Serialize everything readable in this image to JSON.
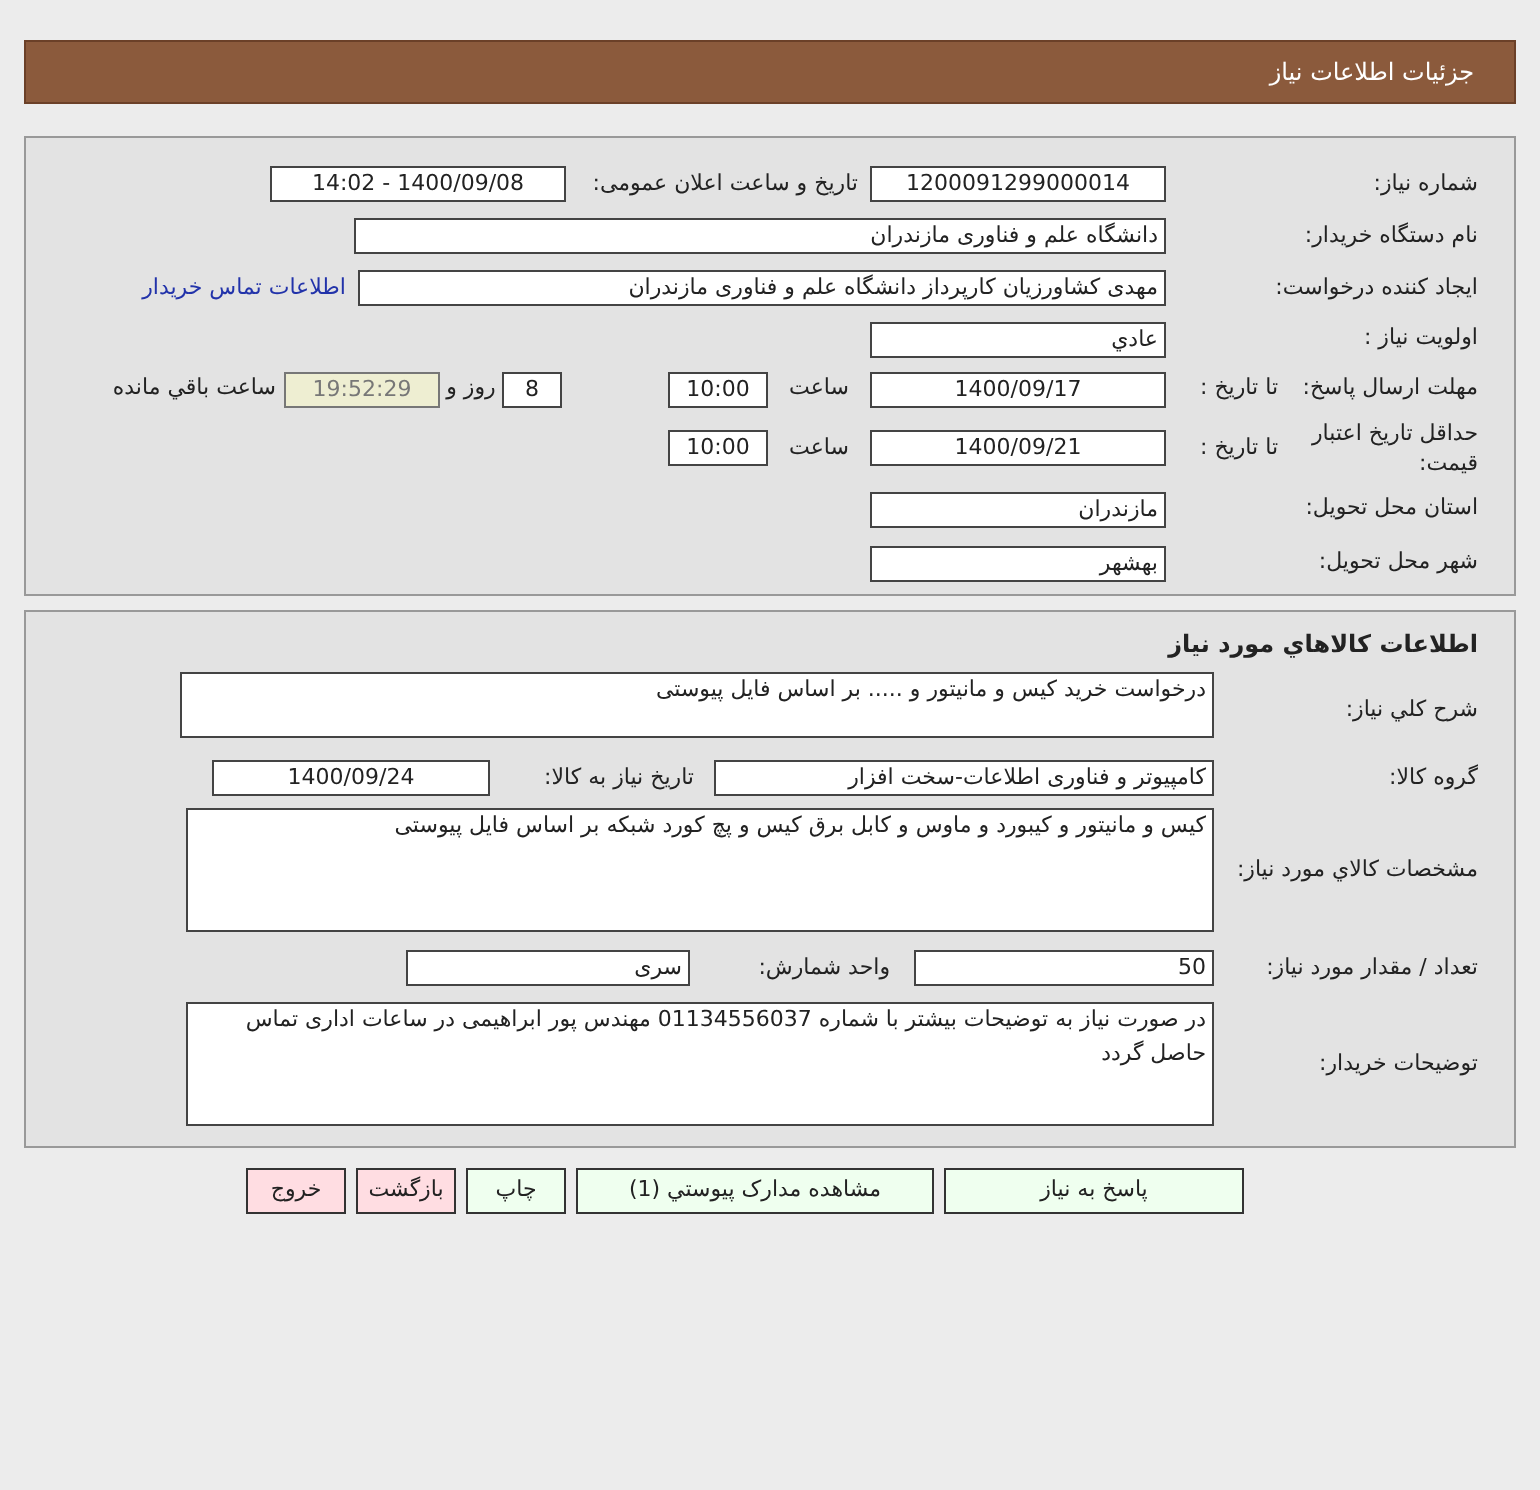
{
  "header": {
    "title": "جزئیات اطلاعات نیاز"
  },
  "general": {
    "need_number": {
      "label": "شماره نیاز:",
      "value": "1200091299000014"
    },
    "announce": {
      "label": "تاریخ و ساعت اعلان عمومی:",
      "value": "1400/09/08 - 14:02"
    },
    "buyer_org": {
      "label": "نام دستگاه خریدار:",
      "value": "دانشگاه علم و فناوری مازندران"
    },
    "requester": {
      "label": "ایجاد کننده درخواست:",
      "value": "مهدی  کشاورزیان کارپرداز دانشگاه علم و فناوری مازندران",
      "link": "اطلاعات تماس خریدار"
    },
    "priority": {
      "label": "اولویت نیاز :",
      "value": "عادي"
    },
    "response_deadline": {
      "label": "مهلت ارسال پاسخ:",
      "to_date_label": "تا تاریخ :",
      "date": "1400/09/17",
      "time_label": "ساعت",
      "time": "10:00",
      "days": "8",
      "days_label": "روز و",
      "remaining": "19:52:29",
      "remaining_label": "ساعت باقي مانده"
    },
    "price_validity": {
      "label": "حداقل تاریخ اعتبار قیمت:",
      "to_date_label": "تا تاریخ :",
      "date": "1400/09/21",
      "time_label": "ساعت",
      "time": "10:00"
    },
    "province": {
      "label": "استان محل تحویل:",
      "value": "مازندران"
    },
    "city": {
      "label": "شهر محل تحویل:",
      "value": "بهشهر"
    }
  },
  "goods": {
    "title": "اطلاعات کالاهاي مورد نياز",
    "summary": {
      "label": "شرح کلي نياز:",
      "value": "درخواست خرید کیس و مانیتور و ..... بر اساس فایل پیوستی"
    },
    "group": {
      "label": "گروه کالا:",
      "value": "کامپیوتر و فناوری اطلاعات-سخت افزار"
    },
    "need_date": {
      "label": "تاریخ نیاز به کالا:",
      "value": "1400/09/24"
    },
    "specs": {
      "label": "مشخصات کالاي مورد نياز:",
      "value": "کیس و مانیتور و کیبورد و ماوس و کابل برق کیس و پچ کورد شبکه بر اساس فایل پیوستی"
    },
    "quantity": {
      "label": "تعداد / مقدار مورد نیاز:",
      "value": "50"
    },
    "unit": {
      "label": "واحد شمارش:",
      "value": "سری"
    },
    "buyer_notes": {
      "label": "توضیحات خریدار:",
      "value": "در صورت نیاز به توضیحات بیشتر با شماره 01134556037 مهندس پور ابراهیمی در ساعات اداری تماس حاصل گردد"
    }
  },
  "buttons": [
    {
      "label": "پاسخ به نیاز",
      "color": "#efffef"
    },
    {
      "label": "مشاهده مدارک پیوستي (1)",
      "color": "#efffef"
    },
    {
      "label": "چاپ",
      "color": "#efffef"
    },
    {
      "label": "بازگشت",
      "color": "#ffdde2"
    },
    {
      "label": "خروج",
      "color": "#ffdde2"
    }
  ]
}
